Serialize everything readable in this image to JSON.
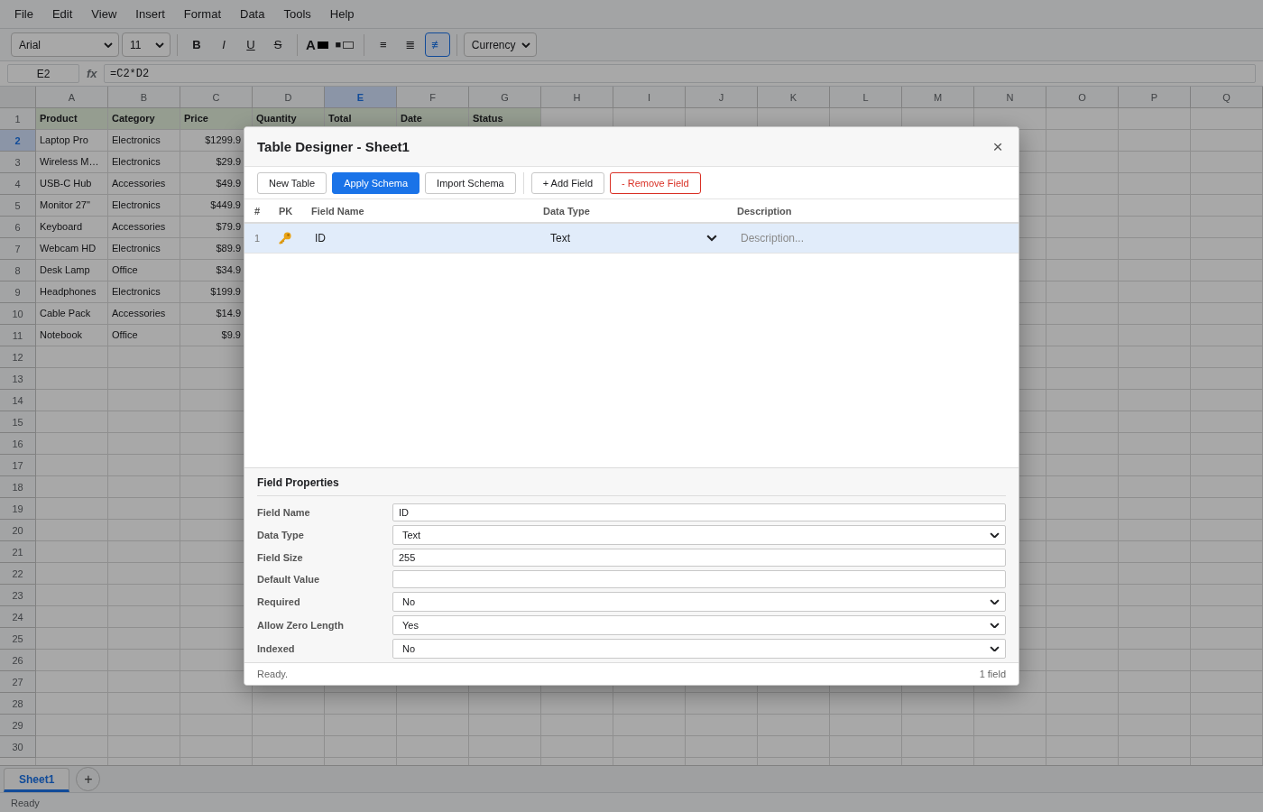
{
  "menu_bar": [
    "File",
    "Edit",
    "View",
    "Insert",
    "Format",
    "Data",
    "Tools",
    "Help"
  ],
  "toolbar": {
    "font": "Arial",
    "font_size": "11",
    "style_buttons": [
      {
        "label": "B",
        "kind": "bold",
        "selected": false
      },
      {
        "label": "I",
        "kind": "italic",
        "selected": false
      },
      {
        "label": "U",
        "kind": "underline",
        "selected": false
      },
      {
        "label": "S",
        "kind": "strikethrough",
        "selected": false
      }
    ],
    "color_buttons": [
      {
        "label": "A",
        "kind": "text"
      },
      {
        "label": "■",
        "kind": "fill"
      }
    ],
    "align_buttons": [
      {
        "label": "≡",
        "selected": false
      },
      {
        "label": "≣",
        "selected": false
      },
      {
        "label": "≢",
        "selected": true
      }
    ],
    "number_format": "Currency"
  },
  "formula_bar": {
    "cell_ref": "E2",
    "fx_label": "fx",
    "formula": "=C2*D2"
  },
  "sheet": {
    "columns": [
      {
        "label": "A",
        "selected": false
      },
      {
        "label": "B",
        "selected": false
      },
      {
        "label": "C",
        "selected": false
      },
      {
        "label": "D",
        "selected": false
      },
      {
        "label": "E",
        "selected": true
      },
      {
        "label": "F",
        "selected": false
      },
      {
        "label": "G",
        "selected": false
      },
      {
        "label": "H",
        "selected": false
      },
      {
        "label": "I",
        "selected": false
      },
      {
        "label": "J",
        "selected": false
      },
      {
        "label": "K",
        "selected": false
      },
      {
        "label": "L",
        "selected": false
      },
      {
        "label": "M",
        "selected": false
      },
      {
        "label": "N",
        "selected": false
      },
      {
        "label": "O",
        "selected": false
      },
      {
        "label": "P",
        "selected": false
      },
      {
        "label": "Q",
        "selected": false
      }
    ],
    "rows": [
      {
        "label": "1",
        "selected": false,
        "cells": [
          {
            "text": "Product",
            "kind": "header"
          },
          {
            "text": "Category",
            "kind": "header"
          },
          {
            "text": "Price",
            "kind": "header"
          },
          {
            "text": "Quantity",
            "kind": "header"
          },
          {
            "text": "Total",
            "kind": "header"
          },
          {
            "text": "Date",
            "kind": "header"
          },
          {
            "text": "Status",
            "kind": "header"
          }
        ]
      },
      {
        "label": "2",
        "selected": true,
        "cells": [
          {
            "text": "Laptop Pro",
            "kind": "text"
          },
          {
            "text": "Electronics",
            "kind": "text"
          },
          {
            "text": "$1299.9",
            "kind": "number"
          }
        ]
      },
      {
        "label": "3",
        "selected": false,
        "cells": [
          {
            "text": "Wireless M…",
            "kind": "text"
          },
          {
            "text": "Electronics",
            "kind": "text"
          },
          {
            "text": "$29.9",
            "kind": "number"
          }
        ]
      },
      {
        "label": "4",
        "selected": false,
        "cells": [
          {
            "text": "USB-C Hub",
            "kind": "text"
          },
          {
            "text": "Accessories",
            "kind": "text"
          },
          {
            "text": "$49.9",
            "kind": "number"
          }
        ]
      },
      {
        "label": "5",
        "selected": false,
        "cells": [
          {
            "text": "Monitor 27\"",
            "kind": "text"
          },
          {
            "text": "Electronics",
            "kind": "text"
          },
          {
            "text": "$449.9",
            "kind": "number"
          }
        ]
      },
      {
        "label": "6",
        "selected": false,
        "cells": [
          {
            "text": "Keyboard",
            "kind": "text"
          },
          {
            "text": "Accessories",
            "kind": "text"
          },
          {
            "text": "$79.9",
            "kind": "number"
          }
        ]
      },
      {
        "label": "7",
        "selected": false,
        "cells": [
          {
            "text": "Webcam HD",
            "kind": "text"
          },
          {
            "text": "Electronics",
            "kind": "text"
          },
          {
            "text": "$89.9",
            "kind": "number"
          }
        ]
      },
      {
        "label": "8",
        "selected": false,
        "cells": [
          {
            "text": "Desk Lamp",
            "kind": "text"
          },
          {
            "text": "Office",
            "kind": "text"
          },
          {
            "text": "$34.9",
            "kind": "number"
          }
        ]
      },
      {
        "label": "9",
        "selected": false,
        "cells": [
          {
            "text": "Headphones",
            "kind": "text"
          },
          {
            "text": "Electronics",
            "kind": "text"
          },
          {
            "text": "$199.9",
            "kind": "number"
          }
        ]
      },
      {
        "label": "10",
        "selected": false,
        "cells": [
          {
            "text": "Cable Pack",
            "kind": "text"
          },
          {
            "text": "Accessories",
            "kind": "text"
          },
          {
            "text": "$14.9",
            "kind": "number"
          }
        ]
      },
      {
        "label": "11",
        "selected": false,
        "cells": [
          {
            "text": "Notebook",
            "kind": "text"
          },
          {
            "text": "Office",
            "kind": "text"
          },
          {
            "text": "$9.9",
            "kind": "number"
          }
        ]
      },
      {
        "label": "12",
        "selected": false
      },
      {
        "label": "13",
        "selected": false
      },
      {
        "label": "14",
        "selected": false
      },
      {
        "label": "15",
        "selected": false
      },
      {
        "label": "16",
        "selected": false
      },
      {
        "label": "17",
        "selected": false
      },
      {
        "label": "18",
        "selected": false
      },
      {
        "label": "19",
        "selected": false
      },
      {
        "label": "20",
        "selected": false
      },
      {
        "label": "21",
        "selected": false
      },
      {
        "label": "22",
        "selected": false
      },
      {
        "label": "23",
        "selected": false
      },
      {
        "label": "24",
        "selected": false
      },
      {
        "label": "25",
        "selected": false
      },
      {
        "label": "26",
        "selected": false
      },
      {
        "label": "27",
        "selected": false
      },
      {
        "label": "28",
        "selected": false
      },
      {
        "label": "29",
        "selected": false
      },
      {
        "label": "30",
        "selected": false
      }
    ]
  },
  "sheet_tabs": {
    "tabs": [
      {
        "label": "Sheet1",
        "selected": true
      }
    ],
    "add_button": "+"
  },
  "status_bar": {
    "text": "Ready"
  },
  "dialog": {
    "title": "Table Designer - Sheet1",
    "close_button": "×",
    "toolbar_groups": [
      {
        "buttons": [
          {
            "label": "New Table",
            "kind": "default"
          },
          {
            "label": "Apply Schema",
            "kind": "primary"
          },
          {
            "label": "Import Schema",
            "kind": "default"
          }
        ]
      },
      {
        "buttons": [
          {
            "label": "+ Add Field",
            "kind": "default"
          },
          {
            "label": "- Remove Field",
            "kind": "danger"
          }
        ]
      }
    ],
    "fields_table": {
      "columns": [
        "#",
        "PK",
        "Field Name",
        "Data Type",
        "Description"
      ],
      "rows": [
        {
          "number": "1",
          "selected": true,
          "primary_key": true,
          "field_name": "ID",
          "data_type": "Text",
          "description": {
            "placeholder": "Description..."
          }
        }
      ]
    },
    "field_properties": {
      "title": "Field Properties",
      "rows": [
        {
          "label": "Field Name",
          "kind": "input",
          "value": "ID"
        },
        {
          "label": "Data Type",
          "kind": "select",
          "value": "Text"
        },
        {
          "label": "Field Size",
          "kind": "input",
          "value": "255"
        },
        {
          "label": "Default Value",
          "kind": "input"
        },
        {
          "label": "Required",
          "kind": "select",
          "value": "No"
        },
        {
          "label": "Allow Zero Length",
          "kind": "select",
          "value": "Yes"
        },
        {
          "label": "Indexed",
          "kind": "select",
          "value": "No"
        }
      ]
    },
    "status_bar": {
      "message": "Ready.",
      "count": "1 field"
    }
  }
}
